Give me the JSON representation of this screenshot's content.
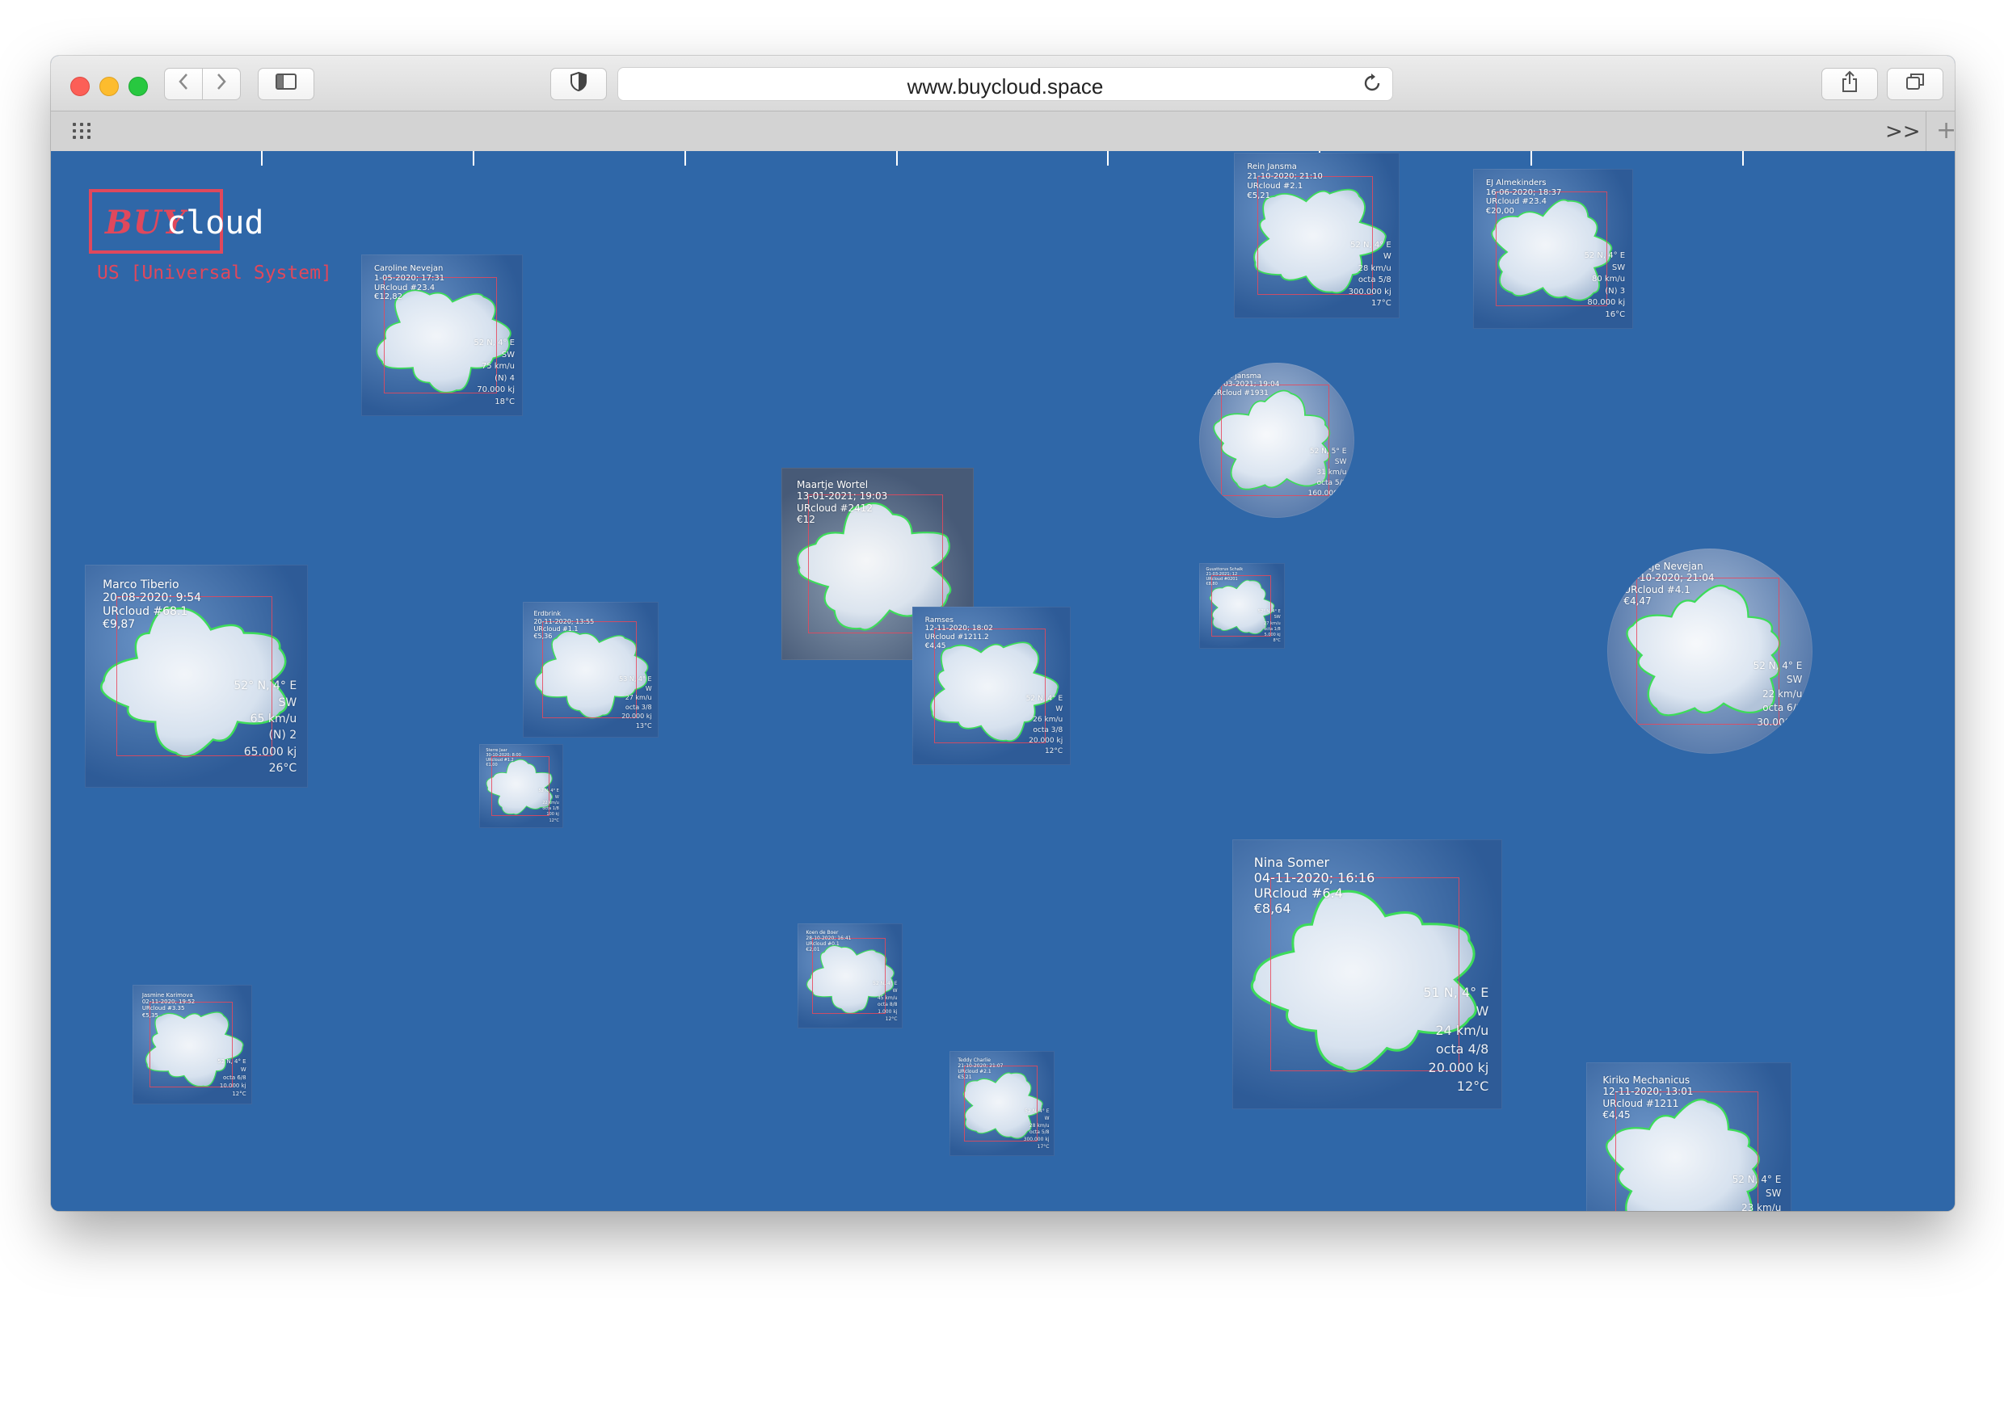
{
  "browser": {
    "url": "www.buycloud.space",
    "tab_more": ">>",
    "tab_add": "+",
    "icons": {
      "back": "chevron-left-icon",
      "forward": "chevron-right-icon",
      "sidebar": "sidebar-icon",
      "shield": "shield-icon",
      "reload": "reload-icon",
      "share": "share-icon",
      "tabs": "tabs-overview-icon",
      "grid": "grid-icon"
    }
  },
  "logo": {
    "buy": "BUY",
    "cloud": "cloud",
    "subtitle": "US [Universal System]",
    "color": "#e0485c"
  },
  "colors": {
    "background": "#2f67a8",
    "outline": "#3ddc5a",
    "frame": "#e0485c"
  },
  "clouds": [
    {
      "name": "Caroline Nevejan",
      "date": "1-05-2020; 17:31",
      "id": "URcloud #23.4",
      "price": "€12,82",
      "coords": "52 N, 4° E",
      "wind_dir": "SW",
      "speed": "75 km/u",
      "cover": "(N) 4",
      "energy": "70.000 kj",
      "temp": "18°C"
    },
    {
      "name": "Rein Jansma",
      "date": "21-10-2020; 21:10",
      "id": "URcloud #2.1",
      "price": "€5,21",
      "coords": "52 N, 4° E",
      "wind_dir": "W",
      "speed": "28 km/u",
      "cover": "octa 5/8",
      "energy": "300.000 kj",
      "temp": "17°C"
    },
    {
      "name": "EJ Almekinders",
      "date": "16-06-2020; 18:37",
      "id": "URcloud #23.4",
      "price": "€20,00",
      "coords": "52 N, 4° E",
      "wind_dir": "SW",
      "speed": "80 km/u",
      "cover": "(N) 3",
      "energy": "80.000 kj",
      "temp": "16°C"
    },
    {
      "name": "Oekie Jansma",
      "date": "19-03-2021; 19:04",
      "id": "URcloud #1931",
      "price": "",
      "coords": "52 N, 5° E",
      "wind_dir": "SW",
      "speed": "31 km/u",
      "cover": "octa 5/8",
      "energy": "160.000 kj",
      "temp": "9°C"
    },
    {
      "name": "Maartje Wortel",
      "date": "13-01-2021; 19:03",
      "id": "URcloud #2412",
      "price": "€12",
      "coords": "52 N, 5° E",
      "wind_dir": "SW",
      "speed": "",
      "cover": "",
      "energy": "",
      "temp": ""
    },
    {
      "name": "Marco Tiberio",
      "date": "20-08-2020; 9:54",
      "id": "URcloud #68.1",
      "price": "€9,87",
      "coords": "52° N, 4° E",
      "wind_dir": "SW",
      "speed": "65 km/u",
      "cover": "(N) 2",
      "energy": "65.000 kj",
      "temp": "26°C"
    },
    {
      "name": "Erdbrink",
      "date": "20-11-2020; 13:55",
      "id": "URcloud #1.1",
      "price": "€5,36",
      "coords": "53 N, 4° E",
      "wind_dir": "W",
      "speed": "27 km/u",
      "cover": "octa 3/8",
      "energy": "20.000 kj",
      "temp": "13°C"
    },
    {
      "name": "Ramses",
      "date": "12-11-2020; 18:02",
      "id": "URcloud #1211.2",
      "price": "€4,45",
      "coords": "52 N, 4° E",
      "wind_dir": "W",
      "speed": "26 km/u",
      "cover": "octa 3/8",
      "energy": "20.000 kj",
      "temp": "12°C"
    },
    {
      "name": "Guusttorus Schalk",
      "date": "21-03-2021; 12",
      "id": "URcloud #0201",
      "price": "€8,80",
      "coords": "52° N, 4° E",
      "wind_dir": "SW",
      "speed": "27 km/u",
      "cover": "octa 1/8",
      "energy": "5.000 kj",
      "temp": "8°C"
    },
    {
      "name": "Maartje Nevejan",
      "date": "16-10-2020; 21:04",
      "id": "URcloud #4.1",
      "price": "€4,47",
      "coords": "52 N, 4° E",
      "wind_dir": "SW",
      "speed": "22 km/u",
      "cover": "octa 6/8",
      "energy": "30.000 kj",
      "temp": "11°C"
    },
    {
      "name": "Sterre Jaar",
      "date": "30-10-2020; 8:00",
      "id": "URcloud #1.2",
      "price": "€1,00",
      "coords": "52 N, 4° E",
      "wind_dir": "W",
      "speed": "22 km/u",
      "cover": "octa 1/8",
      "energy": "100 kj",
      "temp": "12°C"
    },
    {
      "name": "Nina Somer",
      "date": "04-11-2020; 16:16",
      "id": "URcloud #6.4",
      "price": "€8,64",
      "coords": "51 N, 4° E",
      "wind_dir": "W",
      "speed": "24 km/u",
      "cover": "octa 4/8",
      "energy": "20.000 kj",
      "temp": "12°C"
    },
    {
      "name": "Koen de Boer",
      "date": "28-10-2020; 16:41",
      "id": "URcloud #0.1",
      "price": "€2,01",
      "coords": "52 N, 4° E",
      "wind_dir": "W",
      "speed": "45 km/u",
      "cover": "octa 8/8",
      "energy": "1.000 kj",
      "temp": "12°C"
    },
    {
      "name": "Jasmine Karimova",
      "date": "02-11-2020; 19:52",
      "id": "URcloud #3.35",
      "price": "€5,35",
      "coords": "52 N, 4° E",
      "wind_dir": "W",
      "speed": "",
      "cover": "octa 6/8",
      "energy": "10.000 kj",
      "temp": "12°C"
    },
    {
      "name": "Teddy Charlie",
      "date": "21-10-2020; 21:07",
      "id": "URcloud #2.1",
      "price": "€5,21",
      "coords": "52 N, 4° E",
      "wind_dir": "W",
      "speed": "28 km/u",
      "cover": "octa 5/8",
      "energy": "300.000 kj",
      "temp": "17°C"
    },
    {
      "name": "Kiriko Mechanicus",
      "date": "12-11-2020; 13:01",
      "id": "URcloud #1211",
      "price": "€4,45",
      "coords": "52 N, 4° E",
      "wind_dir": "SW",
      "speed": "23 km/u",
      "cover": "octa 2/8",
      "energy": "11.000 kj",
      "temp": "11°C"
    }
  ]
}
